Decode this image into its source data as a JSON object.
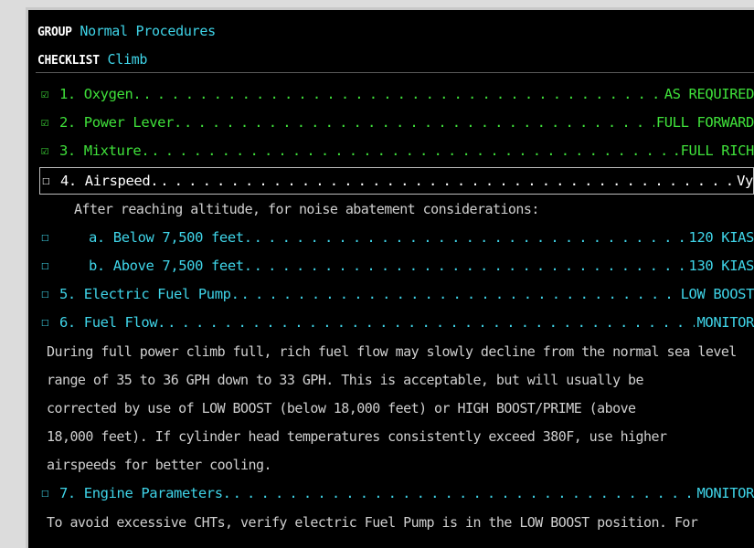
{
  "header": {
    "group_label": "GROUP",
    "group_value": "Normal Procedures",
    "checklist_label": "CHECKLIST",
    "checklist_value": "Climb"
  },
  "items": [
    {
      "checkbox": "☑",
      "label": "1. Oxygen.",
      "action": "AS REQUIRED",
      "status": "done"
    },
    {
      "checkbox": "☑",
      "label": "2. Power Lever.",
      "action": "FULL FORWARD",
      "status": "done"
    },
    {
      "checkbox": "☑",
      "label": "3. Mixture.",
      "action": ".FULL RICH",
      "status": "done"
    },
    {
      "checkbox": "☐",
      "label": "4. Airspeed.",
      "action": "Vy",
      "status": "selected"
    },
    {
      "checkbox": "☐",
      "label": "a. Below 7,500 feet.",
      "action": "120 KIAS",
      "status": "todo"
    },
    {
      "checkbox": "☐",
      "label": "b. Above 7,500 feet.",
      "action": "130 KIAS",
      "status": "todo"
    },
    {
      "checkbox": "☐",
      "label": "5. Electric Fuel Pump.",
      "action": "LOW BOOST",
      "status": "todo"
    },
    {
      "checkbox": "☐",
      "label": "6. Fuel Flow.",
      "action": "MONITOR",
      "status": "todo"
    },
    {
      "checkbox": "☐",
      "label": "7. Engine Parameters.",
      "action": "MONITOR",
      "status": "todo"
    }
  ],
  "notes": {
    "airspeed_note": "After reaching altitude, for noise abatement considerations:",
    "fuel_flow_note": [
      "During full power climb full, rich fuel flow may slowly decline from the normal sea level",
      "range of 35 to 36 GPH down to 33 GPH. This is acceptable, but will usually be",
      "corrected by use of LOW BOOST (below 18,000 feet) or HIGH BOOST/PRIME (above",
      "18,000 feet). If cylinder head temperatures consistently exceed 380F, use higher",
      "airspeeds for better cooling."
    ],
    "engine_note": "To avoid excessive CHTs, verify electric Fuel Pump is in the LOW BOOST position. For"
  },
  "colors": {
    "completed_item": "#3fe03a",
    "pending_item": "#3fd4e8",
    "selected_item": "#ffffff",
    "note_text": "#cfcfcf",
    "background": "#000000"
  }
}
